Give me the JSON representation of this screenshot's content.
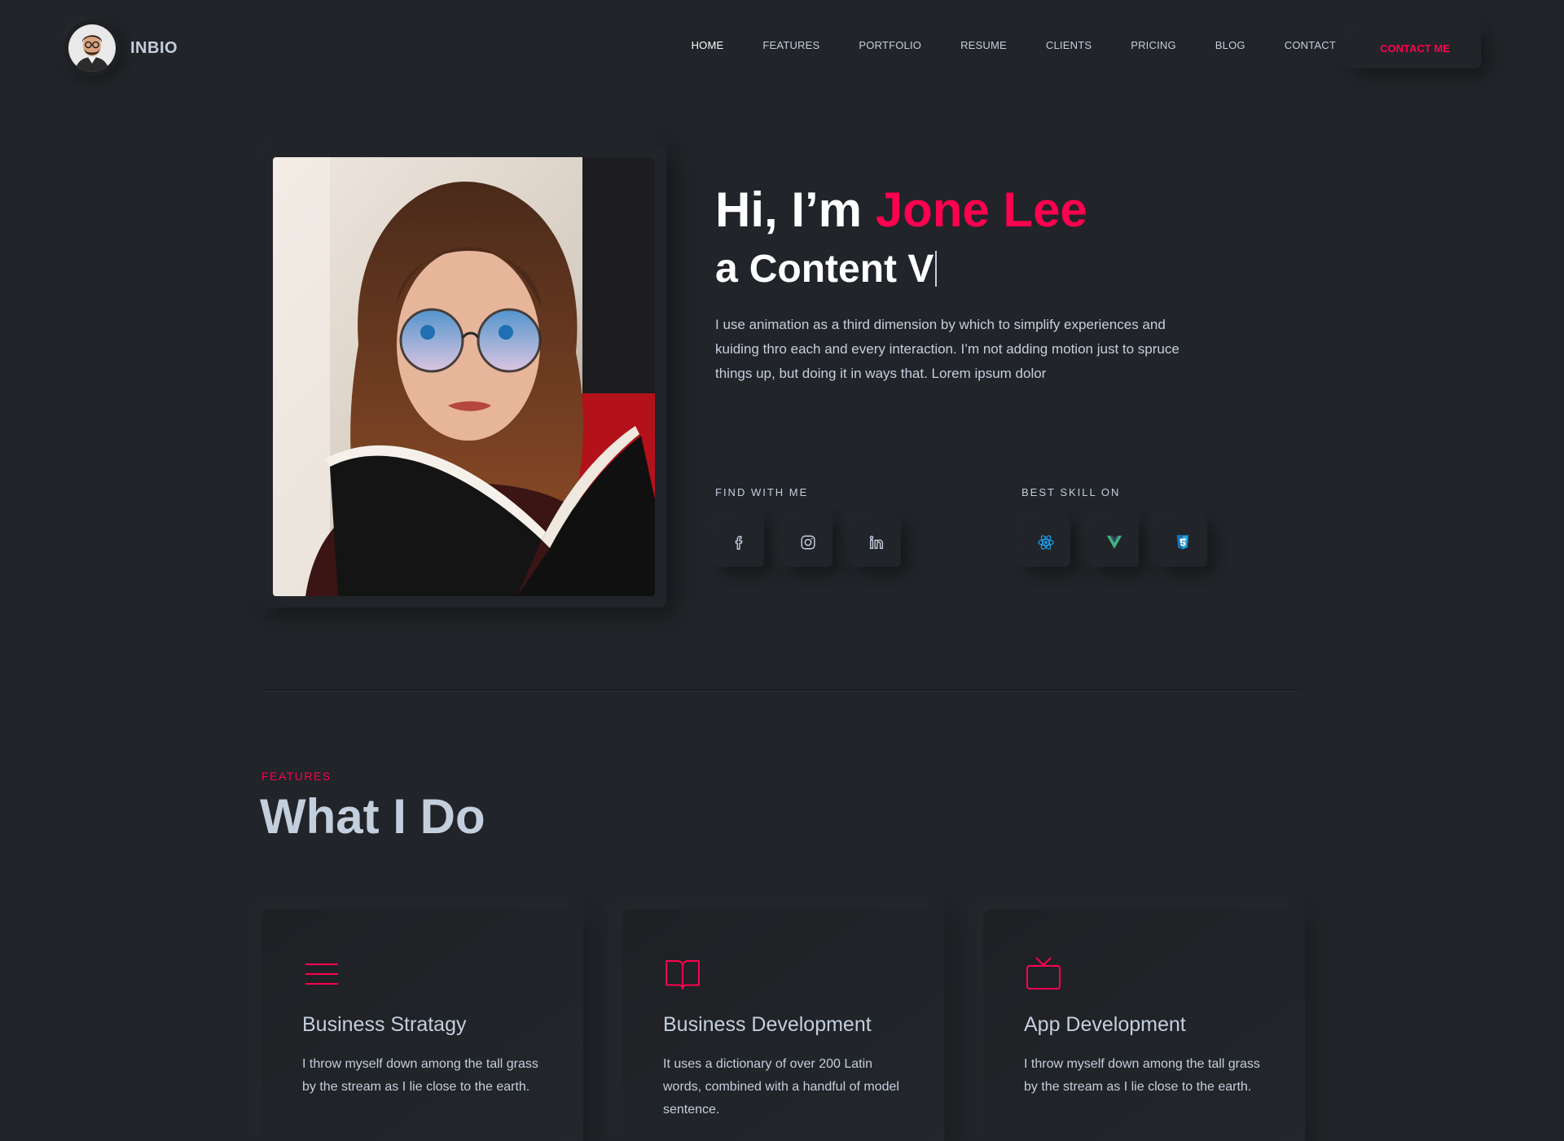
{
  "header": {
    "brand_name": "INBIO",
    "nav": [
      "HOME",
      "FEATURES",
      "PORTFOLIO",
      "RESUME",
      "CLIENTS",
      "PRICING",
      "BLOG",
      "CONTACT"
    ],
    "active_nav": "HOME",
    "cta_label": "CONTACT ME"
  },
  "hero": {
    "greeting": "Hi, I’m ",
    "name": "Jone Lee",
    "prefix": "a ",
    "typed_role": "Content V",
    "description": "I use animation as a third dimension by which to simplify experiences and kuiding thro each and every interaction. I’m not adding motion just to spruce things up, but doing it in ways that. Lorem ipsum dolor",
    "find_label": "FIND WITH ME",
    "skill_label": "BEST SKILL ON",
    "social_icons": [
      "facebook-icon",
      "instagram-icon",
      "linkedin-icon"
    ],
    "skill_icons": [
      "react-icon",
      "vue-icon",
      "css3-icon"
    ]
  },
  "features": {
    "kicker": "FEATURES",
    "title": "What I Do",
    "cards": [
      {
        "icon": "menu-icon",
        "title": "Business Stratagy",
        "desc": "I throw myself down among the tall grass by the stream as I lie close to the earth."
      },
      {
        "icon": "book-icon",
        "title": "Business Development",
        "desc": "It uses a dictionary of over 200 Latin words, combined with a handful of model sentence."
      },
      {
        "icon": "tv-icon",
        "title": "App Development",
        "desc": "I throw myself down among the tall grass by the stream as I lie close to the earth."
      }
    ]
  },
  "colors": {
    "background": "#212428",
    "accent": "#ff014f",
    "text": "#c4cfde",
    "heading": "#ffffff"
  }
}
